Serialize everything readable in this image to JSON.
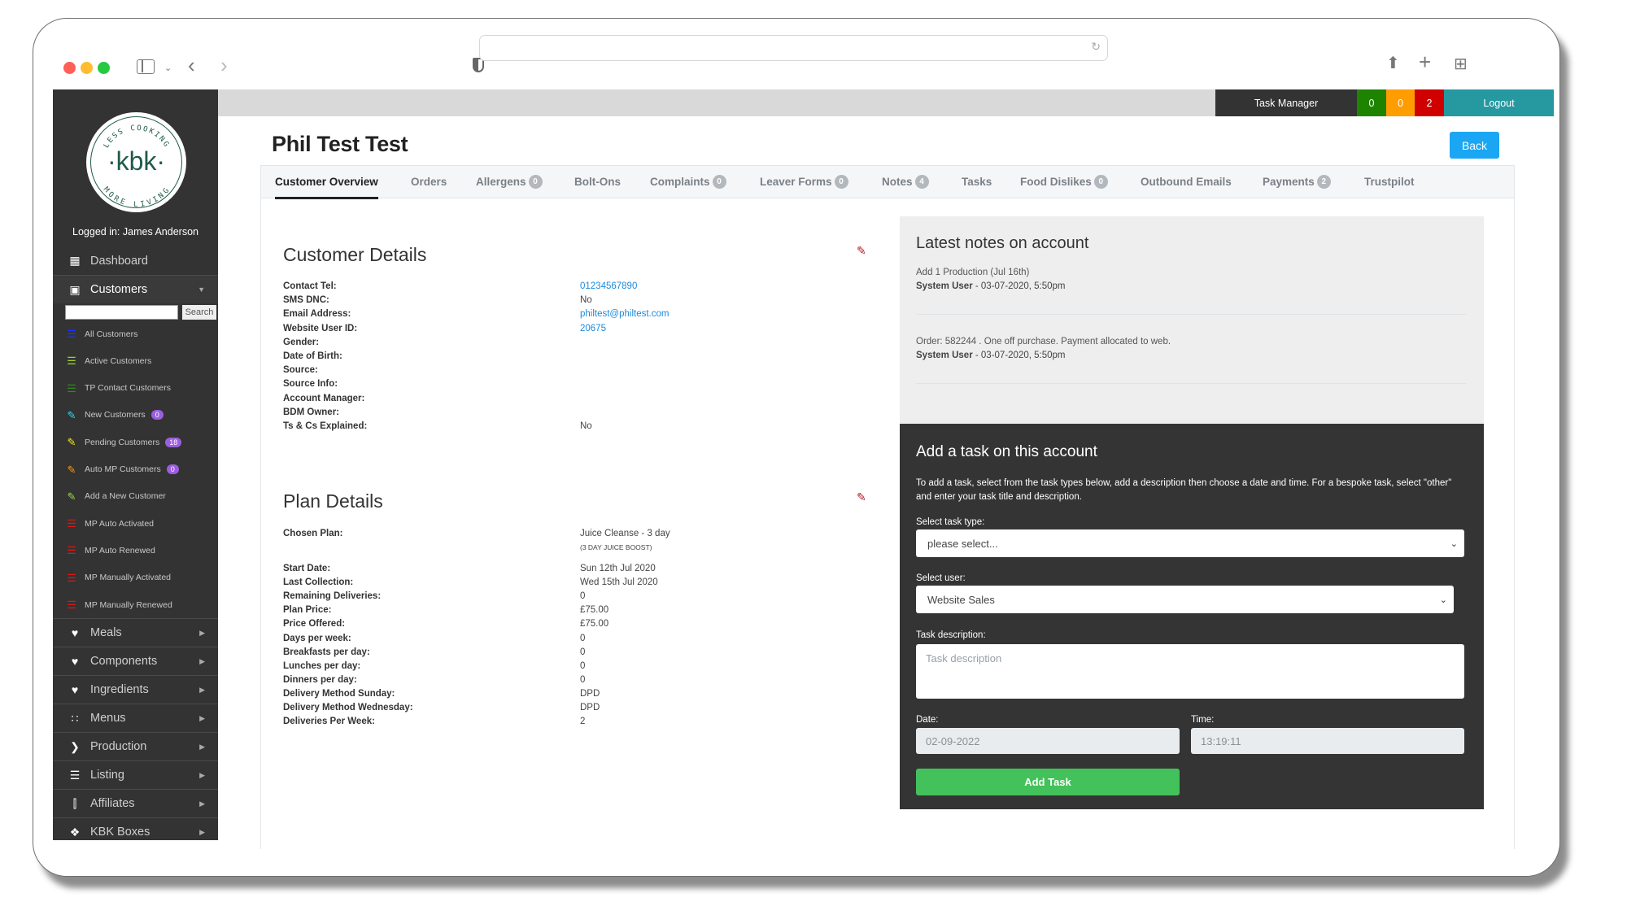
{
  "browser": {
    "url": "",
    "icons": [
      "close-dot",
      "minimize-dot",
      "zoom-dot",
      "sidebar-icon",
      "chevron-down-icon",
      "back-icon",
      "forward-icon",
      "shield-icon",
      "reload-icon",
      "share-icon",
      "new-tab-icon",
      "tab-overview-icon"
    ]
  },
  "topbar": {
    "task_manager": "Task Manager",
    "count_green": "0",
    "count_orange": "0",
    "count_red": "2",
    "logout": "Logout",
    "colors": {
      "green": "#1e8400",
      "orange": "#ff9c00",
      "red": "#d00000",
      "teal": "#2698a0"
    }
  },
  "sidebar": {
    "logo": {
      "center": "·kbk·",
      "top_arc": "LESS COOKING",
      "bottom_arc": "MORE LIVING"
    },
    "logged_in": "Logged in: James Anderson",
    "dashboard": "Dashboard",
    "customers": "Customers",
    "search_button": "Search",
    "search_value": "",
    "customer_items": [
      {
        "label": "All Customers",
        "icon": "list-icon",
        "color": "#1a35ff"
      },
      {
        "label": "Active Customers",
        "icon": "list-icon",
        "color": "#9bd62a"
      },
      {
        "label": "TP Contact Customers",
        "icon": "list-icon",
        "color": "#2f8a1e"
      },
      {
        "label": "New Customers",
        "icon": "pencil-icon",
        "color": "#37d3e6",
        "badge": "0"
      },
      {
        "label": "Pending Customers",
        "icon": "pencil-icon",
        "color": "#f3e614",
        "badge": "18"
      },
      {
        "label": "Auto MP Customers",
        "icon": "pencil-icon",
        "color": "#f29a1b",
        "badge": "0"
      },
      {
        "label": "Add a New Customer",
        "icon": "pencil-icon",
        "color": "#8ee03a"
      },
      {
        "label": "MP Auto Activated",
        "icon": "list-icon",
        "color": "#e01515"
      },
      {
        "label": "MP Auto Renewed",
        "icon": "list-icon",
        "color": "#e01515"
      },
      {
        "label": "MP Manually Activated",
        "icon": "list-icon",
        "color": "#e01515"
      },
      {
        "label": "MP Manually Renewed",
        "icon": "list-icon",
        "color": "#e01515"
      }
    ],
    "sections": [
      {
        "label": "Meals",
        "icon": "heart-icon"
      },
      {
        "label": "Components",
        "icon": "heart-icon"
      },
      {
        "label": "Ingredients",
        "icon": "heart-icon"
      },
      {
        "label": "Menus",
        "icon": "grid-icon"
      },
      {
        "label": "Production",
        "icon": "chevron-right-icon"
      },
      {
        "label": "Listing",
        "icon": "list-icon"
      },
      {
        "label": "Affiliates",
        "icon": "bar-chart-icon"
      },
      {
        "label": "KBK Boxes",
        "icon": "dropbox-icon"
      }
    ]
  },
  "page": {
    "title": "Phil Test Test",
    "back": "Back",
    "tabs": [
      {
        "label": "Customer Overview",
        "active": true
      },
      {
        "label": "Orders"
      },
      {
        "label": "Allergens",
        "badge": "0"
      },
      {
        "label": "Bolt-Ons"
      },
      {
        "label": "Complaints",
        "badge": "0"
      },
      {
        "label": "Leaver Forms",
        "badge": "0"
      },
      {
        "label": "Notes",
        "badge": "4"
      },
      {
        "label": "Tasks"
      },
      {
        "label": "Food Dislikes",
        "badge": "0"
      },
      {
        "label": "Outbound Emails"
      },
      {
        "label": "Payments",
        "badge": "2"
      },
      {
        "label": "Trustpilot"
      }
    ]
  },
  "customer_details": {
    "title": "Customer Details",
    "rows": [
      {
        "label": "Contact Tel:",
        "value": "01234567890",
        "link": true
      },
      {
        "label": "SMS DNC:",
        "value": "No"
      },
      {
        "label": "Email Address:",
        "value": "philtest@philtest.com",
        "link": true
      },
      {
        "label": "Website User ID:",
        "value": "20675",
        "link": true
      },
      {
        "label": "Gender:",
        "value": ""
      },
      {
        "label": "Date of Birth:",
        "value": ""
      },
      {
        "label": "Source:",
        "value": ""
      },
      {
        "label": "Source Info:",
        "value": ""
      },
      {
        "label": "Account Manager:",
        "value": ""
      },
      {
        "label": "BDM Owner:",
        "value": ""
      },
      {
        "label": "Ts & Cs Explained:",
        "value": "No"
      }
    ]
  },
  "plan_details": {
    "title": "Plan Details",
    "chosen_plan_label": "Chosen Plan:",
    "chosen_plan": "Juice Cleanse - 3 day",
    "chosen_plan_sub": "(3 DAY JUICE BOOST)",
    "rows": [
      {
        "label": "Start Date:",
        "value": "Sun 12th Jul 2020"
      },
      {
        "label": "Last Collection:",
        "value": "Wed 15th Jul 2020"
      },
      {
        "label": "Remaining Deliveries:",
        "value": "0"
      },
      {
        "label": "Plan Price:",
        "value": "£75.00"
      },
      {
        "label": "Price Offered:",
        "value": "£75.00"
      },
      {
        "label": "Days per week:",
        "value": "0"
      },
      {
        "label": "Breakfasts per day:",
        "value": "0"
      },
      {
        "label": "Lunches per day:",
        "value": "0"
      },
      {
        "label": "Dinners per day:",
        "value": "0"
      },
      {
        "label": "Delivery Method Sunday:",
        "value": "DPD"
      },
      {
        "label": "Delivery Method Wednesday:",
        "value": "DPD"
      },
      {
        "label": "Deliveries Per Week:",
        "value": "2"
      }
    ]
  },
  "notes": {
    "title": "Latest notes on account",
    "items": [
      {
        "text": "Add 1 Production (Jul 16th)",
        "author": "System User",
        "meta": " - 03-07-2020, 5:50pm"
      },
      {
        "text": "Order: 582244 . One off purchase. Payment allocated to web.",
        "author": "System User",
        "meta": " - 03-07-2020, 5:50pm"
      }
    ]
  },
  "task_form": {
    "title": "Add a task on this account",
    "help": "To add a task, select from the task types below, add a description then choose a date and time. For a bespoke task, select \"other\" and enter your task title and description.",
    "task_type_label": "Select task type:",
    "task_type_value": "please select...",
    "user_label": "Select user:",
    "user_value": "Website Sales",
    "desc_label": "Task description:",
    "desc_placeholder": "Task description",
    "date_label": "Date:",
    "date_value": "02-09-2022",
    "time_label": "Time:",
    "time_value": "13:19:11",
    "submit": "Add Task"
  }
}
